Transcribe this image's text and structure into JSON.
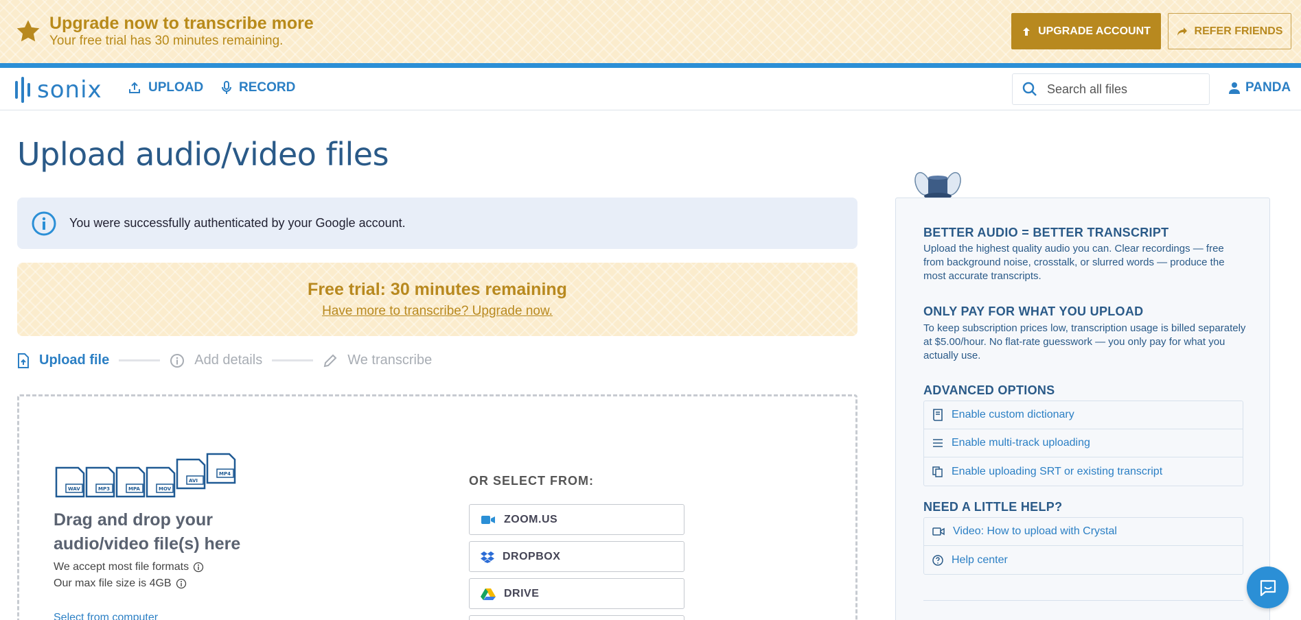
{
  "banner": {
    "title": "Upgrade now to transcribe more",
    "subtitle": "Your free trial has 30 minutes remaining.",
    "upgrade_label": "UPGRADE ACCOUNT",
    "refer_label": "REFER FRIENDS"
  },
  "nav": {
    "logo_text": "sonix",
    "upload_label": "UPLOAD",
    "record_label": "RECORD",
    "search_placeholder": "Search all files",
    "user_label": "PANDA"
  },
  "main": {
    "title": "Upload audio/video files",
    "alert_text": "You were successfully authenticated by your Google account.",
    "trial_title": "Free trial: 30 minutes remaining",
    "trial_link": "Have more to transcribe? Upgrade now.",
    "steps": [
      {
        "label": "Upload file",
        "icon": "upload-file-icon"
      },
      {
        "label": "Add details",
        "icon": "info-icon"
      },
      {
        "label": "We transcribe",
        "icon": "pencil-icon"
      }
    ],
    "dropzone": {
      "file_types": [
        "WAV",
        "MP3",
        "MPA",
        "MOV",
        "AVI",
        "MP4"
      ],
      "title": "Drag and drop your audio/video file(s) here",
      "formats_text": "We accept most file formats",
      "size_text": "Our max file size is 4GB",
      "select_link": "Select from computer",
      "or_label": "OR SELECT FROM:",
      "sources": [
        {
          "label": "ZOOM.US",
          "icon": "zoom-icon"
        },
        {
          "label": "DROPBOX",
          "icon": "dropbox-icon"
        },
        {
          "label": "DRIVE",
          "icon": "google-drive-icon"
        }
      ]
    }
  },
  "sidebar": {
    "tip1_title": "BETTER AUDIO = BETTER TRANSCRIPT",
    "tip1_text": "Upload the highest quality audio you can. Clear recordings — free from background noise, crosstalk, or slurred words — produce the most accurate transcripts.",
    "tip2_title": "ONLY PAY FOR WHAT YOU UPLOAD",
    "tip2_text": "To keep subscription prices low, transcription usage is billed separately at $5.00/hour. No flat-rate guesswork — you only pay for what you actually use.",
    "advanced_title": "ADVANCED OPTIONS",
    "advanced_items": [
      {
        "label": "Enable custom dictionary",
        "icon": "book-icon"
      },
      {
        "label": "Enable multi-track uploading",
        "icon": "list-icon"
      },
      {
        "label": "Enable uploading SRT or existing transcript",
        "icon": "copy-icon"
      }
    ],
    "help_title": "NEED A LITTLE HELP?",
    "help_items": [
      {
        "label": "Video: How to upload with Crystal",
        "icon": "video-icon"
      },
      {
        "label": "Help center",
        "icon": "question-icon"
      }
    ]
  },
  "colors": {
    "accent_blue": "#2b7fc4",
    "gold": "#b8891f",
    "banner_bg": "#fbeccd"
  }
}
